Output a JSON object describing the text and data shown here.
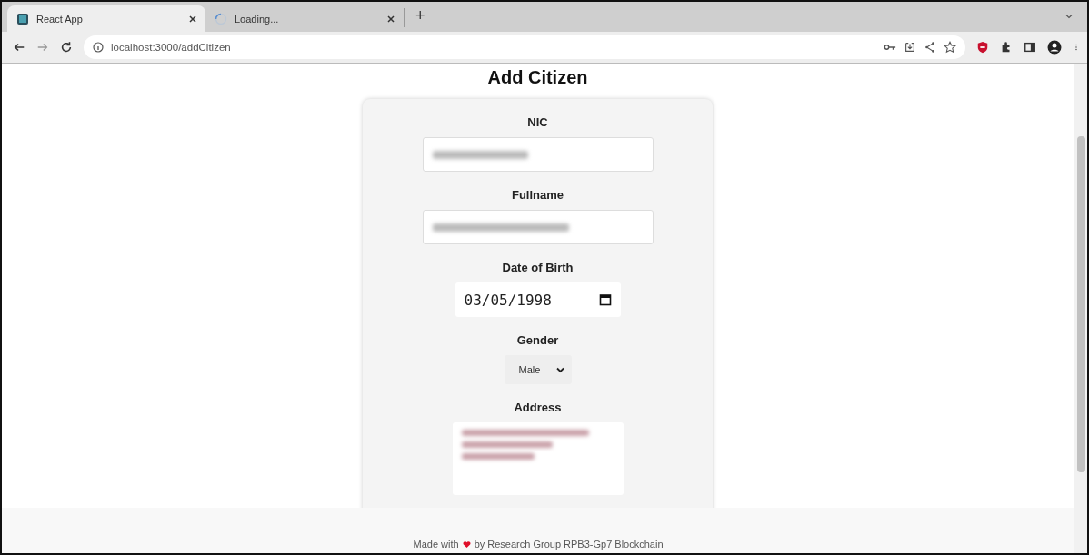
{
  "browser": {
    "tabs": [
      {
        "title": "React App",
        "kind": "app",
        "selected": true
      },
      {
        "title": "Loading...",
        "kind": "loading",
        "selected": false
      }
    ],
    "new_tab": "+",
    "address": "localhost:3000/addCitizen"
  },
  "page": {
    "heading": "Add Citizen",
    "fields": [
      {
        "kind": "text",
        "label": "NIC",
        "blurred": true
      },
      {
        "kind": "text",
        "label": "Fullname",
        "blurred": true
      },
      {
        "kind": "date",
        "label": "Date of Birth",
        "value": "03/05/1998"
      },
      {
        "kind": "select",
        "label": "Gender",
        "value": "Male"
      },
      {
        "kind": "textarea",
        "label": "Address",
        "blurred": true
      }
    ]
  },
  "footer": {
    "before": "Made with",
    "after": "by Research Group RPB3-Gp7 Blockchain"
  }
}
